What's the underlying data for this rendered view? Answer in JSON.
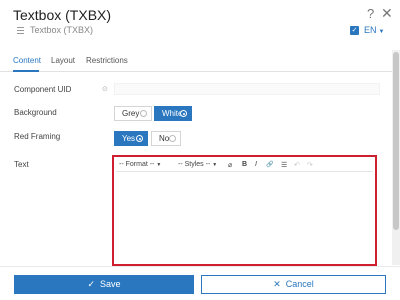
{
  "dialog": {
    "title": "Textbox (TXBX)",
    "subtitle": "Textbox (TXBX)",
    "help_icon": "?",
    "close_icon": "✕",
    "language": "EN"
  },
  "tabs": [
    {
      "label": "Content",
      "active": true
    },
    {
      "label": "Layout",
      "active": false
    },
    {
      "label": "Restrictions",
      "active": false
    }
  ],
  "fields": {
    "component_uid": {
      "label": "Component UID",
      "value": "",
      "placeholder": ""
    },
    "background": {
      "label": "Background",
      "options": [
        "Grey",
        "White"
      ],
      "selected": "White"
    },
    "red_framing": {
      "label": "Red Framing",
      "options": [
        "Yes",
        "No"
      ],
      "selected": "Yes"
    },
    "text": {
      "label": "Text"
    }
  },
  "editor": {
    "format_select": "-- Format --",
    "styles_select": "-- Styles --",
    "buttons": {
      "clear": "⌀",
      "bold": "B",
      "italic": "I",
      "link": "🔗",
      "list": "☰",
      "undo": "↶",
      "redo": "↷"
    },
    "content": ""
  },
  "footer": {
    "save_label": "Save",
    "cancel_label": "Cancel",
    "save_icon": "✓",
    "cancel_icon": "✕"
  },
  "colors": {
    "accent": "#2a77bf",
    "frame_red": "#cf1f2f"
  }
}
